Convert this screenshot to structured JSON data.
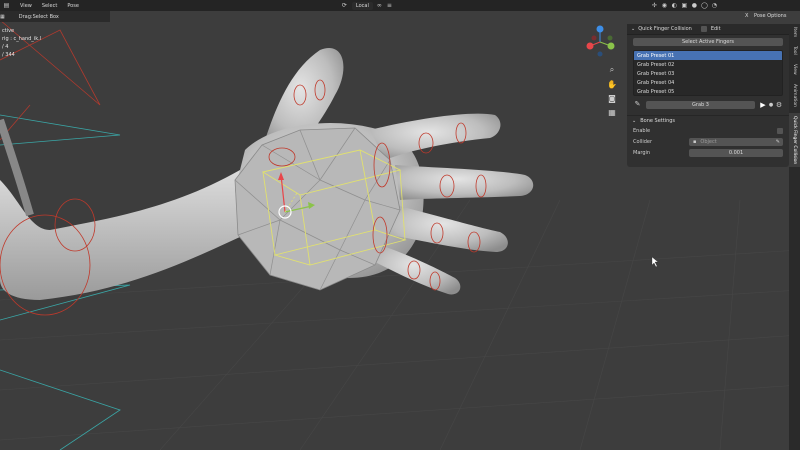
{
  "header": {
    "menu": [
      "View",
      "Select",
      "Pose"
    ],
    "transform_orientation": "Local",
    "pose_options": "Pose Options",
    "x_label": "X"
  },
  "toolrow": {
    "drag_label": "Drag:",
    "drag_value": "Select Box"
  },
  "overlay": {
    "line1": "ctive",
    "line2": "rig : c_hand_ik.l",
    "line3": "/ 4",
    "line4": "/ 344"
  },
  "npanel": {
    "title": "Quick Finger Collision",
    "edit_label": "Edit",
    "select_active_fingers": "Select Active Fingers",
    "presets": [
      "Grab Preset 01",
      "Grab Preset 02",
      "Grab Preset 03",
      "Grab Preset 04",
      "Grab Preset 05"
    ],
    "selected_preset_index": 0,
    "grab_label": "Grab 3",
    "bone_settings_title": "Bone Settings",
    "enable_label": "Enable",
    "collider_label": "Collider",
    "collider_placeholder": "Object",
    "margin_label": "Margin",
    "margin_value": "0.001"
  },
  "sidebar_tabs": [
    "Item",
    "Tool",
    "View",
    "Animation",
    "Quick Finger Collision"
  ],
  "colors": {
    "header_bg": "#232323",
    "viewport_bg": "#3d3d3d",
    "panel_bg": "#303030",
    "selected": "#4772b3",
    "bone_circle": "#c0392b",
    "cage_yellow": "#e0e070",
    "gizmo_x": "#e8464a",
    "gizmo_y": "#8bc34a",
    "gizmo_z": "#3d8ee8"
  },
  "icons": [
    "search-icon",
    "hand-icon",
    "camera-icon",
    "grid-icon",
    "cursor-icon",
    "gear-icon",
    "play-icon"
  ]
}
